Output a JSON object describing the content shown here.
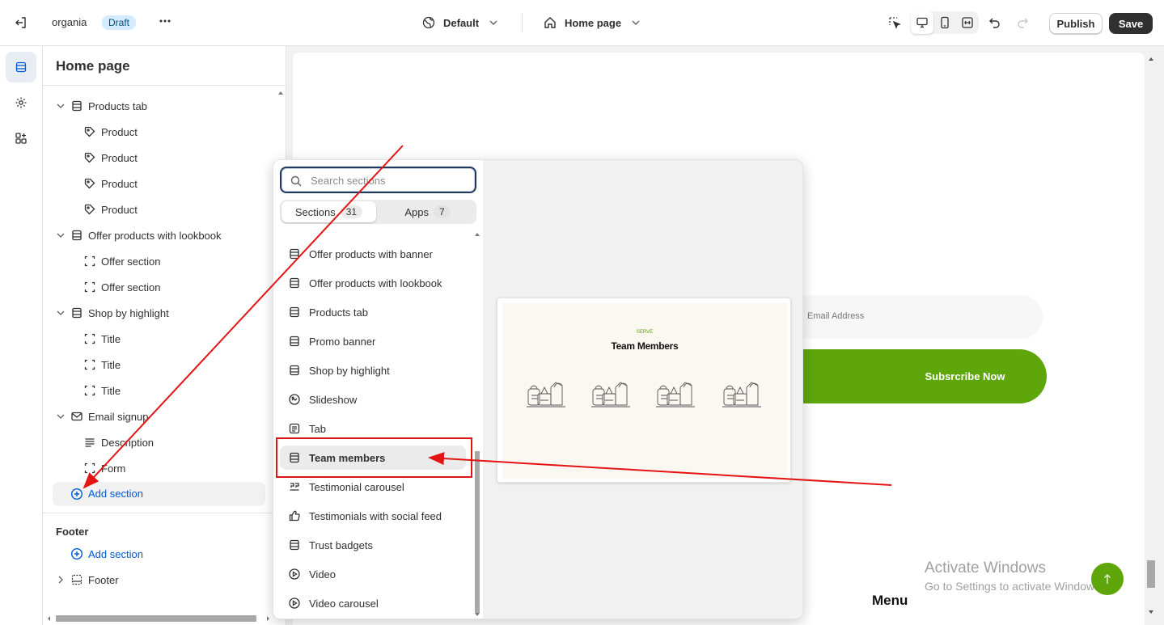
{
  "topbar": {
    "store_name": "organia",
    "status_badge": "Draft",
    "theme_name": "Default",
    "page_name": "Home page",
    "publish_label": "Publish",
    "save_label": "Save"
  },
  "sidebar": {
    "title": "Home page",
    "tree": [
      {
        "label": "Products tab",
        "icon": "section-icon",
        "level": 0,
        "expanded": true
      },
      {
        "label": "Product",
        "icon": "tag-icon",
        "level": 1
      },
      {
        "label": "Product",
        "icon": "tag-icon",
        "level": 1
      },
      {
        "label": "Product",
        "icon": "tag-icon",
        "level": 1
      },
      {
        "label": "Product",
        "icon": "tag-icon",
        "level": 1
      },
      {
        "label": "Offer products with lookbook",
        "icon": "section-icon",
        "level": 0,
        "expanded": true
      },
      {
        "label": "Offer section",
        "icon": "block-icon",
        "level": 1
      },
      {
        "label": "Offer section",
        "icon": "block-icon",
        "level": 1
      },
      {
        "label": "Shop by highlight",
        "icon": "section-icon",
        "level": 0,
        "expanded": true
      },
      {
        "label": "Title",
        "icon": "block-icon",
        "level": 1
      },
      {
        "label": "Title",
        "icon": "block-icon",
        "level": 1
      },
      {
        "label": "Title",
        "icon": "block-icon",
        "level": 1
      },
      {
        "label": "Email signup",
        "icon": "email-icon",
        "level": 0,
        "expanded": true
      },
      {
        "label": "Description",
        "icon": "text-icon",
        "level": 1
      },
      {
        "label": "Form",
        "icon": "block-icon",
        "level": 1
      }
    ],
    "add_section_label": "Add section",
    "footer_group_title": "Footer",
    "footer_add_section_label": "Add section",
    "footer_item_label": "Footer"
  },
  "popover": {
    "search_placeholder": "Search sections",
    "tabs": [
      {
        "label": "Sections",
        "count": "31",
        "active": true
      },
      {
        "label": "Apps",
        "count": "7",
        "active": false
      }
    ],
    "items": [
      {
        "label": "Offer products with banner",
        "icon": "section-icon"
      },
      {
        "label": "Offer products with lookbook",
        "icon": "section-icon"
      },
      {
        "label": "Products tab",
        "icon": "section-icon"
      },
      {
        "label": "Promo banner",
        "icon": "section-icon"
      },
      {
        "label": "Shop by highlight",
        "icon": "section-icon"
      },
      {
        "label": "Slideshow",
        "icon": "slideshow-icon"
      },
      {
        "label": "Tab",
        "icon": "text-block-icon"
      },
      {
        "label": "Team members",
        "icon": "section-icon",
        "highlighted": true
      },
      {
        "label": "Testimonial carousel",
        "icon": "quote-icon"
      },
      {
        "label": "Testimonials with social feed",
        "icon": "thumbs-up-icon"
      },
      {
        "label": "Trust badgets",
        "icon": "section-icon"
      },
      {
        "label": "Video",
        "icon": "play-icon"
      },
      {
        "label": "Video carousel",
        "icon": "play-icon"
      }
    ],
    "preview": {
      "eyebrow": "SERVE",
      "title": "Team Members"
    }
  },
  "canvas": {
    "email_placeholder": "Email Address",
    "subscribe_label": "Subsrcribe Now",
    "menu_heading": "Menu",
    "watermark_line1": "Activate Windows",
    "watermark_line2": "Go to Settings to activate Windows."
  },
  "colors": {
    "accent_green": "#5ea60a",
    "link_blue": "#005bd3",
    "annotation_red": "#e31414",
    "save_dark": "#303030"
  }
}
